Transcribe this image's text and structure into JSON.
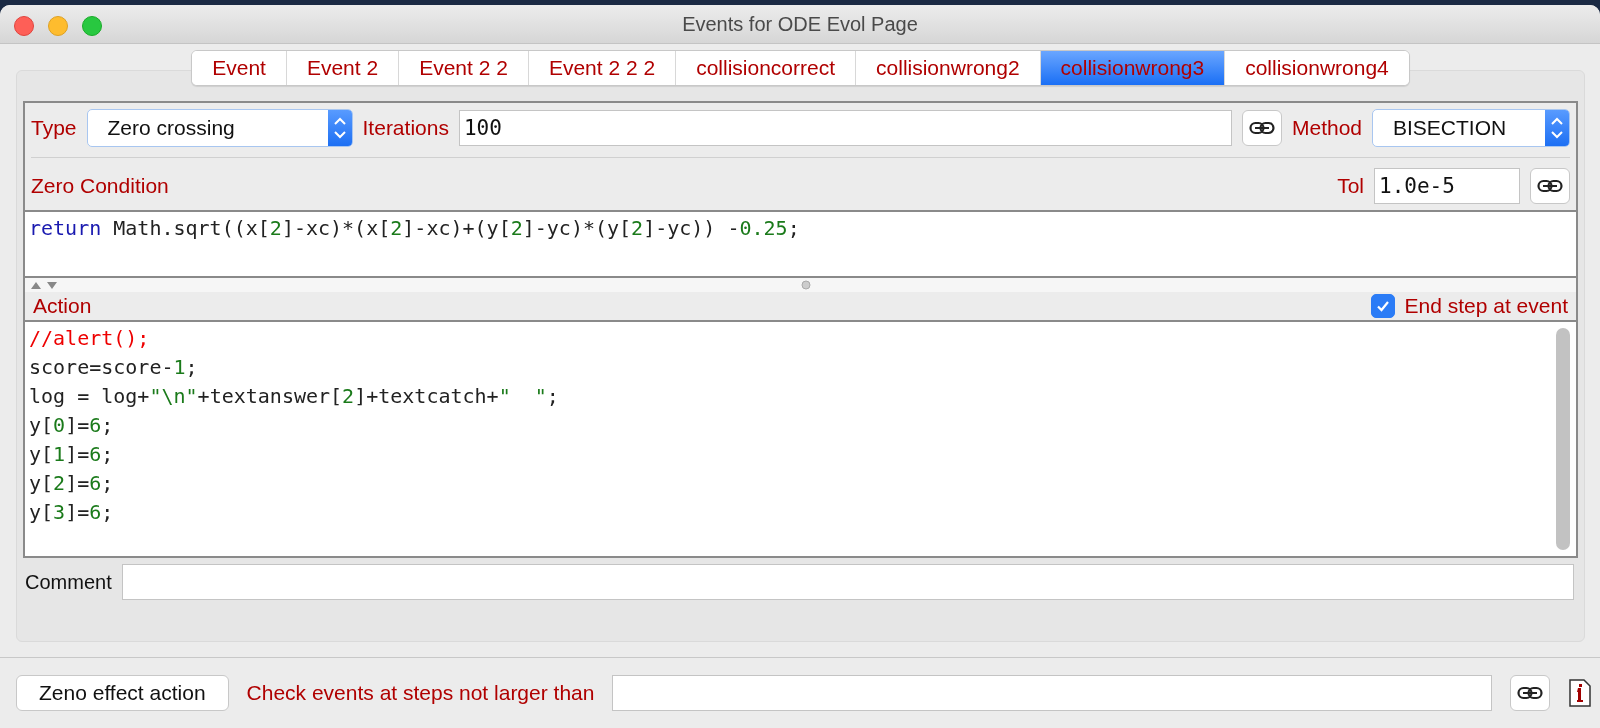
{
  "window": {
    "title": "Events for ODE Evol Page"
  },
  "tabs": [
    {
      "label": "Event",
      "selected": false
    },
    {
      "label": "Event 2",
      "selected": false
    },
    {
      "label": "Event 2 2",
      "selected": false
    },
    {
      "label": "Event 2 2 2",
      "selected": false
    },
    {
      "label": "collisioncorrect",
      "selected": false
    },
    {
      "label": "collisionwrong2",
      "selected": false
    },
    {
      "label": "collisionwrong3",
      "selected": true
    },
    {
      "label": "collisionwrong4",
      "selected": false
    }
  ],
  "settings": {
    "type_label": "Type",
    "type_value": "Zero crossing",
    "iterations_label": "Iterations",
    "iterations_value": "100",
    "method_label": "Method",
    "method_value": "BISECTION"
  },
  "zero_condition": {
    "label": "Zero Condition",
    "tol_label": "Tol",
    "tol_value": "1.0e-5",
    "code": [
      [
        {
          "kind": "keyword",
          "text": "return"
        },
        {
          "kind": "plain",
          "text": " Math.sqrt((x["
        },
        {
          "kind": "number",
          "text": "2"
        },
        {
          "kind": "plain",
          "text": "]-xc)*(x["
        },
        {
          "kind": "number",
          "text": "2"
        },
        {
          "kind": "plain",
          "text": "]-xc)+(y["
        },
        {
          "kind": "number",
          "text": "2"
        },
        {
          "kind": "plain",
          "text": "]-yc)*(y["
        },
        {
          "kind": "number",
          "text": "2"
        },
        {
          "kind": "plain",
          "text": "]-yc)) -"
        },
        {
          "kind": "number",
          "text": "0.25"
        },
        {
          "kind": "plain",
          "text": ";"
        }
      ]
    ]
  },
  "action": {
    "label": "Action",
    "end_step_label": "End step at event",
    "end_step_checked": true,
    "code": [
      [
        {
          "kind": "comment",
          "text": "//alert();"
        }
      ],
      [
        {
          "kind": "plain",
          "text": "score=score-"
        },
        {
          "kind": "number",
          "text": "1"
        },
        {
          "kind": "plain",
          "text": ";"
        }
      ],
      [
        {
          "kind": "plain",
          "text": "log = log+"
        },
        {
          "kind": "string",
          "text": "\"\\n\""
        },
        {
          "kind": "plain",
          "text": "+textanswer["
        },
        {
          "kind": "number",
          "text": "2"
        },
        {
          "kind": "plain",
          "text": "]+textcatch+"
        },
        {
          "kind": "string",
          "text": "\"  \""
        },
        {
          "kind": "plain",
          "text": ";"
        }
      ],
      [
        {
          "kind": "plain",
          "text": "y["
        },
        {
          "kind": "number",
          "text": "0"
        },
        {
          "kind": "plain",
          "text": "]="
        },
        {
          "kind": "number",
          "text": "6"
        },
        {
          "kind": "plain",
          "text": ";"
        }
      ],
      [
        {
          "kind": "plain",
          "text": "y["
        },
        {
          "kind": "number",
          "text": "1"
        },
        {
          "kind": "plain",
          "text": "]="
        },
        {
          "kind": "number",
          "text": "6"
        },
        {
          "kind": "plain",
          "text": ";"
        }
      ],
      [
        {
          "kind": "plain",
          "text": "y["
        },
        {
          "kind": "number",
          "text": "2"
        },
        {
          "kind": "plain",
          "text": "]="
        },
        {
          "kind": "number",
          "text": "6"
        },
        {
          "kind": "plain",
          "text": ";"
        }
      ],
      [
        {
          "kind": "plain",
          "text": "y["
        },
        {
          "kind": "number",
          "text": "3"
        },
        {
          "kind": "plain",
          "text": "]="
        },
        {
          "kind": "number",
          "text": "6"
        },
        {
          "kind": "plain",
          "text": ";"
        }
      ]
    ]
  },
  "comment": {
    "label": "Comment"
  },
  "bottom": {
    "zeno_button": "Zeno effect action",
    "check_label": "Check events at steps not larger than"
  }
}
